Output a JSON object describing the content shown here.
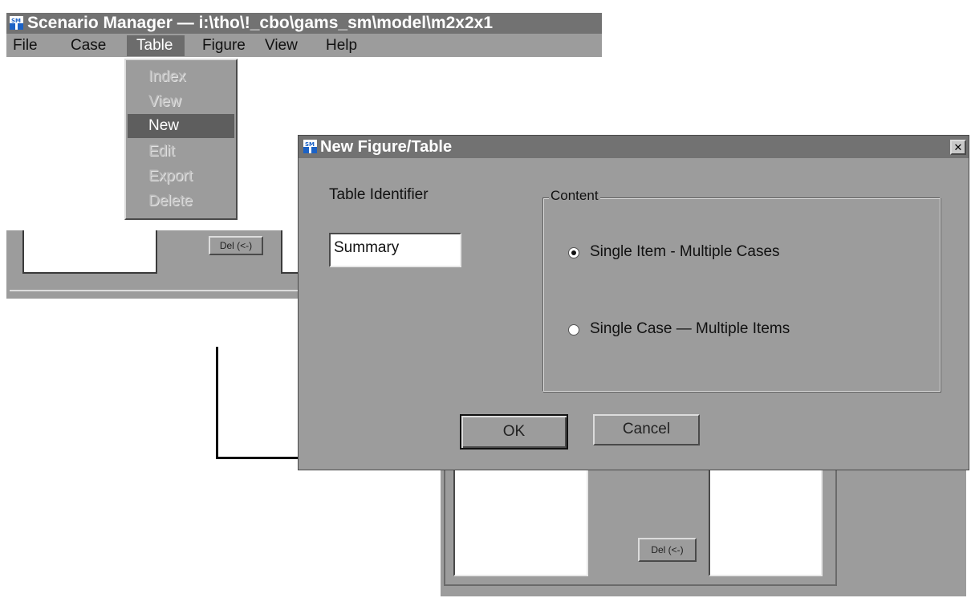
{
  "main_window": {
    "title": "Scenario Manager — i:\\tho\\!_cbo\\gams_sm\\model\\m2x2x1",
    "menu": [
      "File",
      "Case",
      "Table",
      "Figure",
      "View",
      "Help"
    ],
    "del_button": "Del (<-)"
  },
  "table_menu": {
    "items": [
      {
        "label": "Index",
        "enabled": false
      },
      {
        "label": "View",
        "enabled": false
      },
      {
        "label": "New",
        "enabled": true,
        "highlighted": true
      },
      {
        "label": "Edit",
        "enabled": false
      },
      {
        "label": "Export",
        "enabled": false
      },
      {
        "label": "Delete",
        "enabled": false
      }
    ]
  },
  "dialog": {
    "title": "New Figure/Table",
    "close_glyph": "✕",
    "identifier_label": "Table Identifier",
    "identifier_value": "Summary",
    "content_group": "Content",
    "options": [
      {
        "label": "Single Item - Multiple Cases",
        "selected": true
      },
      {
        "label": "Single Case — Multiple Items",
        "selected": false
      }
    ],
    "ok_label": "OK",
    "cancel_label": "Cancel"
  },
  "lower_window": {
    "del_button": "Del (<-)"
  },
  "icons": {
    "app_icon": "sm-app-icon"
  },
  "colors": {
    "face": "#9c9c9c",
    "titlebar": "#727272",
    "highlight": "#5e5e5e"
  }
}
